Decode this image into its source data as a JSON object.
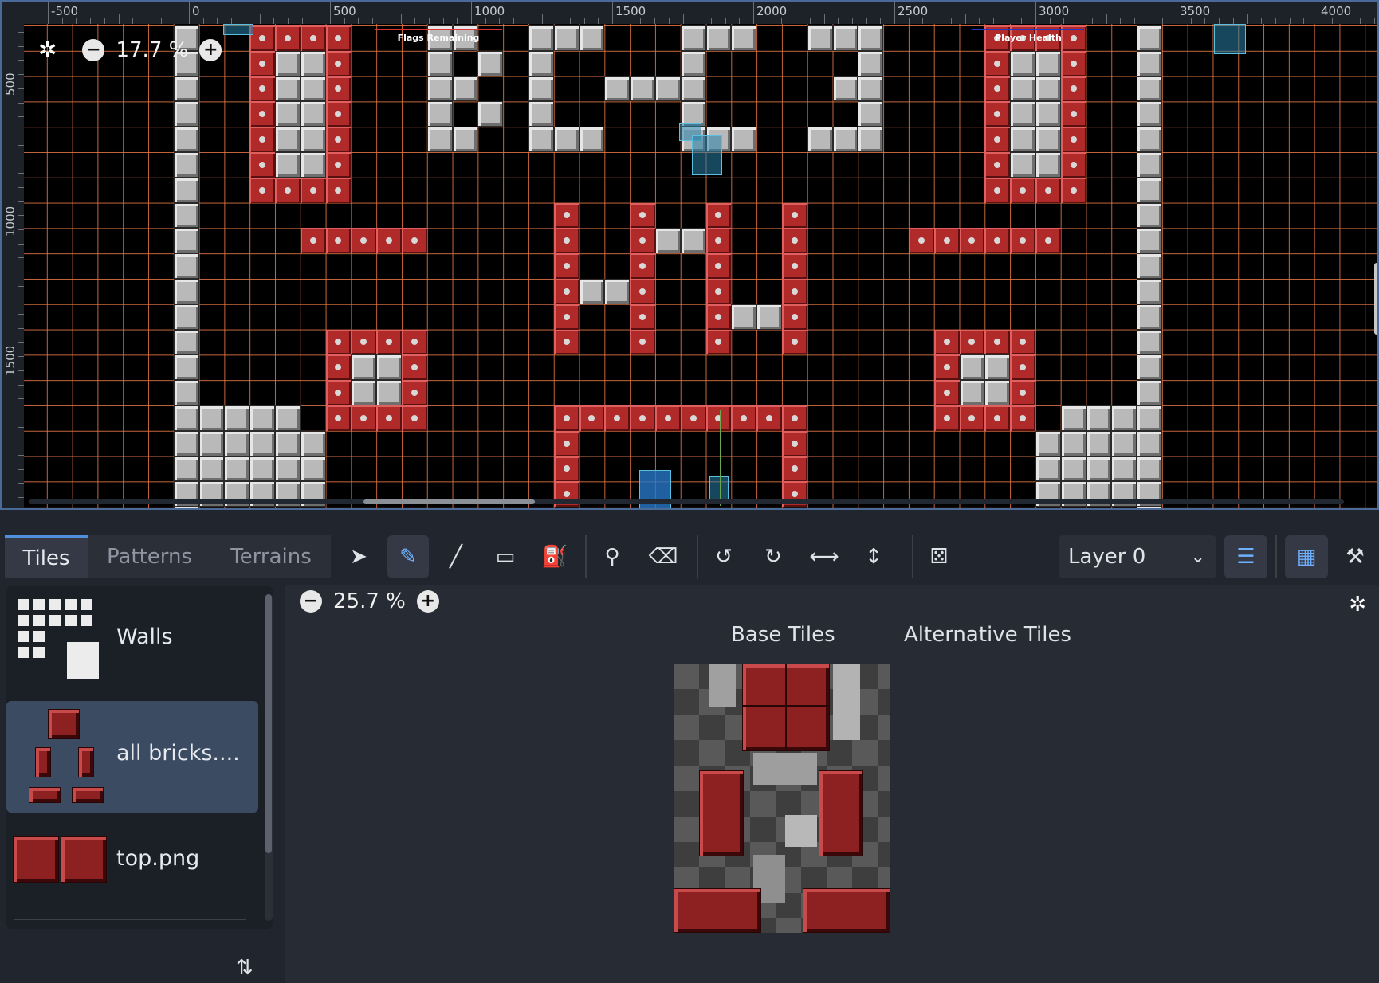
{
  "viewport": {
    "zoom": "17.7 %",
    "hud_flags": "Flags Remaining",
    "hud_health": "Player Health",
    "ruler_top_labels": [
      "-500",
      "0",
      "500",
      "1000",
      "1500",
      "2000",
      "2500",
      "3000",
      "3500",
      "4000"
    ],
    "ruler_left_labels": [
      "500",
      "1000",
      "1500"
    ],
    "icons": {
      "center": "center-view-icon",
      "zoom_out": "zoom-out-icon",
      "zoom_in": "zoom-in-icon"
    }
  },
  "bottom_panel": {
    "tabs": [
      "Tiles",
      "Patterns",
      "Terrains"
    ],
    "active_tab": "Tiles",
    "tools": [
      {
        "name": "select-icon",
        "glyph": "➤"
      },
      {
        "name": "paint-icon",
        "glyph": "✎"
      },
      {
        "name": "line-icon",
        "glyph": "╱"
      },
      {
        "name": "rect-icon",
        "glyph": "▭"
      },
      {
        "name": "bucket-icon",
        "glyph": "⛽"
      },
      {
        "name": "picker-icon",
        "glyph": "⚲"
      },
      {
        "name": "eraser-icon",
        "glyph": "⌫"
      },
      {
        "name": "rotate-left-icon",
        "glyph": "↺"
      },
      {
        "name": "rotate-right-icon",
        "glyph": "↻"
      },
      {
        "name": "flip-h-icon",
        "glyph": "⟷"
      },
      {
        "name": "flip-v-icon",
        "glyph": "↕"
      },
      {
        "name": "random-icon",
        "glyph": "⚄"
      }
    ],
    "layer": "Layer 0",
    "sources": [
      {
        "label": "Walls"
      },
      {
        "label": "all bricks...."
      },
      {
        "label": "top.png"
      }
    ],
    "atlas_zoom": "25.7 %",
    "atlas_tabs": [
      "Base Tiles",
      "Alternative Tiles"
    ],
    "colors": {
      "accent": "#4f8fdc",
      "selected_bg": "#3b4b62",
      "grid": "#e87846",
      "brick": "#b02a2a",
      "wall": "#b9b9b9"
    }
  }
}
